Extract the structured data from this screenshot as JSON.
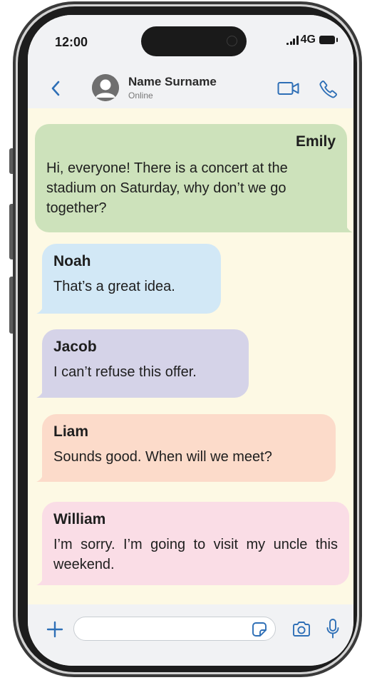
{
  "status_bar": {
    "time": "12:00",
    "network": "4G"
  },
  "chat_header": {
    "contact_name": "Name Surname",
    "contact_status": "Online",
    "icons": [
      "back-chevron-icon",
      "avatar-icon",
      "video-camera-icon",
      "phone-icon"
    ]
  },
  "messages": [
    {
      "sender": "Emily",
      "text": "Hi, everyone! There is a concert at the stadium on Saturday, why don’t we go together?",
      "color": "#cde2bb",
      "align": "right"
    },
    {
      "sender": "Noah",
      "text": "That’s a great idea.",
      "color": "#d2e8f6",
      "align": "left"
    },
    {
      "sender": "Jacob",
      "text": "I can’t refuse this offer.",
      "color": "#d5d3e8",
      "align": "left"
    },
    {
      "sender": "Liam",
      "text": "Sounds good. When will we meet?",
      "color": "#fcdbca",
      "align": "left"
    },
    {
      "sender": "William",
      "text": "I’m sorry. I’m going to visit my uncle this weekend.",
      "color": "#fadde6",
      "align": "left"
    }
  ],
  "input_bar": {
    "value": "",
    "icons": [
      "plus-icon",
      "sticker-icon",
      "camera-icon",
      "microphone-icon"
    ]
  },
  "colors": {
    "accent": "#2e6fb6",
    "chat_background": "#fdf9e4",
    "bar_background": "#f1f2f4",
    "phone_frame": "#1d1d1d"
  }
}
